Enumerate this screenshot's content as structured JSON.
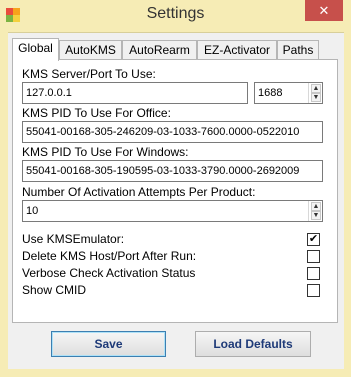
{
  "window": {
    "title": "Settings",
    "close_glyph": "✕"
  },
  "tabs": [
    {
      "label": "Global"
    },
    {
      "label": "AutoKMS"
    },
    {
      "label": "AutoRearm"
    },
    {
      "label": "EZ-Activator"
    },
    {
      "label": "Paths"
    }
  ],
  "global": {
    "kms_server_label": "KMS Server/Port To Use:",
    "kms_server_value": "127.0.0.1",
    "kms_port_value": "1688",
    "pid_office_label": "KMS PID To Use For Office:",
    "pid_office_value": "55041-00168-305-246209-03-1033-7600.0000-0522010",
    "pid_windows_label": "KMS PID To Use For Windows:",
    "pid_windows_value": "55041-00168-305-190595-03-1033-3790.0000-2692009",
    "attempts_label": "Number Of Activation Attempts Per Product:",
    "attempts_value": "10",
    "options": [
      {
        "label": "Use KMSEmulator:",
        "checked": true
      },
      {
        "label": "Delete KMS Host/Port After Run:",
        "checked": false
      },
      {
        "label": "Verbose Check Activation Status",
        "checked": false
      },
      {
        "label": "Show CMID",
        "checked": false
      }
    ]
  },
  "buttons": {
    "save": "Save",
    "load_defaults": "Load Defaults"
  },
  "icons": {
    "spin_up": "▲",
    "spin_down": "▼",
    "check_mark": "✔"
  },
  "colors": {
    "titlebar": "#f6ecb5",
    "close_button": "#c7504b",
    "button_text": "#1e3a78"
  }
}
